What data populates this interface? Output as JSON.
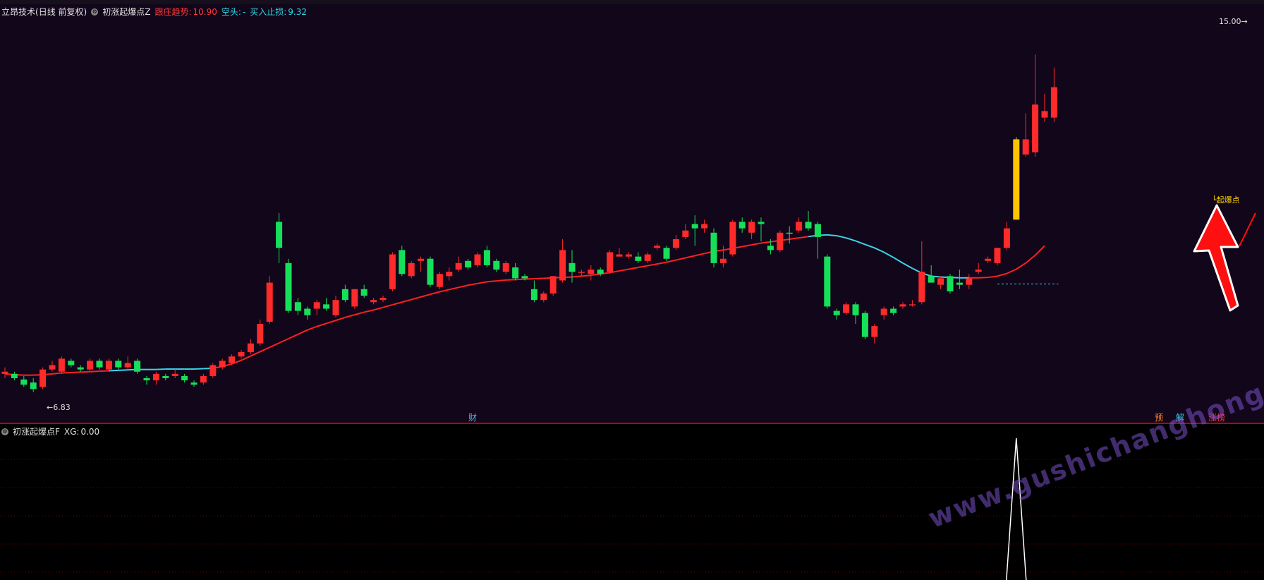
{
  "main_header": {
    "indicator_name": "立昂技术",
    "period": "(日线 前复权)",
    "formula_name": "初涨起爆点Z",
    "long_label": "跟庄趋势:",
    "long_value": "10.90",
    "short_label": "空头:",
    "short_value": "-",
    "stop_label": "买入止损:",
    "stop_value": "9.32"
  },
  "sub_header": {
    "formula_name": "初涨起爆点F",
    "xg_label": "XG:",
    "xg_value": "0.00"
  },
  "price_labels": {
    "high": "15.00",
    "low": "6.83",
    "signal": "起爆点"
  },
  "event_tags": [
    {
      "text": "财",
      "color": "#4fb6ff"
    },
    {
      "text": "预",
      "color": "#ff8a2a"
    },
    {
      "text": "解",
      "color": "#30d8e6"
    },
    {
      "text": "涨榜",
      "color": "#ff3b3b"
    }
  ],
  "watermark": "www.gushichanghong.com",
  "colors": {
    "up": "#ff2a2a",
    "down": "#16e05a",
    "signal_bar": "#ffc400",
    "trend_up": "#ff2020",
    "trend_down": "#38d6e8",
    "arrow": "#ff1010"
  },
  "chart_data": {
    "type": "candlestick",
    "ylim": [
      6.5,
      15.5
    ],
    "high_marker": 15.0,
    "low_marker": 6.83,
    "stop_line": 9.32,
    "candles": [
      [
        7.3,
        7.25,
        7.4,
        7.15,
        "u"
      ],
      [
        7.25,
        7.15,
        7.3,
        7.1,
        "d"
      ],
      [
        7.12,
        7.0,
        7.2,
        6.95,
        "d"
      ],
      [
        7.05,
        6.9,
        7.15,
        6.83,
        "d"
      ],
      [
        6.95,
        7.35,
        7.4,
        6.9,
        "u"
      ],
      [
        7.35,
        7.45,
        7.55,
        7.3,
        "u"
      ],
      [
        7.3,
        7.6,
        7.65,
        7.25,
        "u"
      ],
      [
        7.55,
        7.45,
        7.6,
        7.4,
        "d"
      ],
      [
        7.4,
        7.35,
        7.45,
        7.3,
        "d"
      ],
      [
        7.35,
        7.55,
        7.6,
        7.3,
        "u"
      ],
      [
        7.55,
        7.4,
        7.6,
        7.35,
        "d"
      ],
      [
        7.35,
        7.55,
        7.6,
        7.3,
        "u"
      ],
      [
        7.55,
        7.4,
        7.6,
        7.35,
        "d"
      ],
      [
        7.4,
        7.5,
        7.65,
        7.35,
        "u"
      ],
      [
        7.55,
        7.3,
        7.6,
        7.25,
        "d"
      ],
      [
        7.15,
        7.1,
        7.2,
        7.0,
        "d"
      ],
      [
        7.1,
        7.25,
        7.3,
        7.0,
        "u"
      ],
      [
        7.2,
        7.15,
        7.25,
        7.1,
        "d"
      ],
      [
        7.2,
        7.25,
        7.35,
        7.15,
        "u"
      ],
      [
        7.2,
        7.1,
        7.25,
        7.05,
        "d"
      ],
      [
        7.05,
        7.0,
        7.1,
        6.95,
        "d"
      ],
      [
        7.05,
        7.2,
        7.25,
        7.0,
        "u"
      ],
      [
        7.2,
        7.45,
        7.5,
        7.15,
        "u"
      ],
      [
        7.4,
        7.55,
        7.6,
        7.35,
        "u"
      ],
      [
        7.5,
        7.65,
        7.7,
        7.45,
        "u"
      ],
      [
        7.65,
        7.75,
        7.8,
        7.6,
        "u"
      ],
      [
        7.75,
        7.95,
        8.05,
        7.7,
        "u"
      ],
      [
        7.95,
        8.4,
        8.5,
        7.9,
        "u"
      ],
      [
        8.45,
        9.35,
        9.5,
        8.4,
        "u"
      ],
      [
        10.15,
        10.75,
        10.95,
        9.8,
        "d"
      ],
      [
        9.8,
        8.7,
        9.9,
        8.65,
        "d"
      ],
      [
        8.9,
        8.7,
        9.0,
        8.6,
        "d"
      ],
      [
        8.75,
        8.6,
        8.8,
        8.5,
        "d"
      ],
      [
        8.75,
        8.9,
        8.95,
        8.6,
        "u"
      ],
      [
        8.85,
        8.75,
        9.0,
        8.7,
        "d"
      ],
      [
        8.6,
        8.95,
        9.05,
        8.55,
        "u"
      ],
      [
        9.2,
        8.95,
        9.3,
        8.9,
        "d"
      ],
      [
        8.8,
        9.2,
        9.2,
        8.75,
        "u"
      ],
      [
        9.2,
        9.05,
        9.3,
        9.0,
        "d"
      ],
      [
        8.95,
        8.9,
        9.0,
        8.85,
        "u"
      ],
      [
        8.95,
        9.0,
        9.05,
        8.9,
        "u"
      ],
      [
        9.2,
        10.0,
        10.05,
        9.15,
        "u"
      ],
      [
        10.1,
        9.55,
        10.2,
        9.5,
        "d"
      ],
      [
        9.5,
        9.8,
        9.85,
        9.45,
        "u"
      ],
      [
        9.9,
        9.85,
        9.95,
        9.6,
        "u"
      ],
      [
        9.9,
        9.3,
        9.95,
        9.25,
        "d"
      ],
      [
        9.25,
        9.55,
        9.6,
        9.2,
        "u"
      ],
      [
        9.5,
        9.6,
        9.7,
        9.4,
        "u"
      ],
      [
        9.65,
        9.8,
        9.95,
        9.6,
        "u"
      ],
      [
        9.85,
        9.7,
        9.9,
        9.65,
        "d"
      ],
      [
        9.75,
        10.0,
        10.05,
        9.7,
        "u"
      ],
      [
        10.1,
        9.75,
        10.2,
        9.7,
        "d"
      ],
      [
        9.85,
        9.65,
        9.9,
        9.6,
        "d"
      ],
      [
        9.6,
        9.8,
        9.85,
        9.55,
        "u"
      ],
      [
        9.7,
        9.45,
        9.8,
        9.4,
        "d"
      ],
      [
        9.5,
        9.45,
        9.55,
        9.4,
        "d"
      ],
      [
        9.2,
        8.95,
        9.4,
        8.9,
        "d"
      ],
      [
        8.95,
        9.1,
        9.15,
        8.9,
        "u"
      ],
      [
        9.1,
        9.5,
        9.5,
        9.05,
        "u"
      ],
      [
        9.4,
        10.1,
        10.35,
        9.35,
        "u"
      ],
      [
        9.8,
        9.6,
        10.1,
        9.35,
        "d"
      ],
      [
        9.6,
        9.6,
        9.65,
        9.5,
        "u"
      ],
      [
        9.55,
        9.65,
        9.75,
        9.4,
        "u"
      ],
      [
        9.65,
        9.55,
        9.7,
        9.5,
        "d"
      ],
      [
        9.6,
        10.05,
        10.1,
        9.55,
        "u"
      ],
      [
        10.0,
        9.95,
        10.15,
        9.95,
        "u"
      ],
      [
        9.95,
        10.0,
        10.05,
        9.9,
        "u"
      ],
      [
        9.95,
        9.85,
        10.05,
        9.8,
        "d"
      ],
      [
        9.85,
        10.0,
        10.05,
        9.8,
        "u"
      ],
      [
        10.15,
        10.2,
        10.25,
        10.1,
        "u"
      ],
      [
        10.15,
        9.9,
        10.2,
        9.85,
        "d"
      ],
      [
        10.15,
        10.35,
        10.45,
        10.1,
        "u"
      ],
      [
        10.4,
        10.55,
        10.7,
        10.35,
        "u"
      ],
      [
        10.7,
        10.6,
        10.9,
        10.2,
        "d"
      ],
      [
        10.7,
        10.6,
        10.8,
        10.5,
        "u"
      ],
      [
        10.5,
        9.8,
        10.6,
        9.7,
        "d"
      ],
      [
        9.8,
        9.9,
        10.2,
        9.7,
        "u"
      ],
      [
        10.0,
        10.75,
        10.8,
        9.95,
        "u"
      ],
      [
        10.75,
        10.6,
        10.85,
        10.5,
        "d"
      ],
      [
        10.5,
        10.75,
        10.8,
        10.35,
        "u"
      ],
      [
        10.7,
        10.75,
        10.85,
        10.3,
        "d"
      ],
      [
        10.2,
        10.1,
        10.35,
        10.0,
        "d"
      ],
      [
        10.1,
        10.5,
        10.55,
        10.05,
        "u"
      ],
      [
        10.5,
        10.5,
        10.65,
        10.25,
        "d"
      ],
      [
        10.55,
        10.75,
        10.85,
        10.5,
        "u"
      ],
      [
        10.75,
        10.6,
        11.0,
        10.55,
        "d"
      ],
      [
        10.7,
        10.4,
        10.75,
        9.9,
        "d"
      ],
      [
        9.95,
        8.8,
        10.0,
        8.75,
        "d"
      ],
      [
        8.7,
        8.6,
        8.75,
        8.5,
        "d"
      ],
      [
        8.65,
        8.85,
        8.9,
        8.6,
        "u"
      ],
      [
        8.85,
        8.6,
        8.9,
        8.4,
        "d"
      ],
      [
        8.65,
        8.1,
        8.7,
        8.05,
        "d"
      ],
      [
        8.1,
        8.35,
        8.4,
        7.95,
        "u"
      ],
      [
        8.6,
        8.75,
        8.8,
        8.5,
        "u"
      ],
      [
        8.75,
        8.65,
        8.8,
        8.6,
        "d"
      ],
      [
        8.8,
        8.85,
        8.9,
        8.75,
        "u"
      ],
      [
        8.85,
        8.85,
        8.95,
        8.8,
        "u"
      ],
      [
        8.9,
        9.6,
        10.3,
        8.85,
        "u"
      ],
      [
        9.5,
        9.35,
        9.75,
        9.35,
        "d"
      ],
      [
        9.45,
        9.3,
        9.5,
        9.2,
        "u"
      ],
      [
        9.5,
        9.15,
        9.55,
        9.1,
        "d"
      ],
      [
        9.3,
        9.35,
        9.65,
        9.2,
        "d"
      ],
      [
        9.3,
        9.45,
        9.55,
        9.2,
        "u"
      ],
      [
        9.6,
        9.65,
        9.8,
        9.55,
        "u"
      ],
      [
        9.85,
        9.9,
        9.95,
        9.8,
        "u"
      ],
      [
        9.8,
        10.15,
        10.15,
        9.75,
        "u"
      ],
      [
        10.15,
        10.6,
        10.75,
        10.1,
        "u"
      ],
      [
        10.8,
        12.65,
        12.7,
        10.8,
        "s"
      ],
      [
        12.3,
        12.65,
        13.25,
        12.25,
        "u"
      ],
      [
        12.35,
        13.45,
        14.6,
        12.25,
        "u"
      ],
      [
        13.3,
        13.15,
        13.7,
        13.05,
        "u"
      ],
      [
        13.15,
        13.85,
        14.3,
        13.05,
        "u"
      ]
    ],
    "trend": [
      7.25,
      7.23,
      7.22,
      7.22,
      7.23,
      7.25,
      7.27,
      7.28,
      7.29,
      7.3,
      7.31,
      7.32,
      7.33,
      7.34,
      7.35,
      7.35,
      7.35,
      7.36,
      7.36,
      7.36,
      7.36,
      7.37,
      7.38,
      7.42,
      7.48,
      7.56,
      7.66,
      7.76,
      7.86,
      7.96,
      8.06,
      8.16,
      8.26,
      8.34,
      8.41,
      8.48,
      8.55,
      8.61,
      8.67,
      8.72,
      8.78,
      8.84,
      8.9,
      8.96,
      9.02,
      9.08,
      9.14,
      9.19,
      9.24,
      9.29,
      9.33,
      9.37,
      9.39,
      9.41,
      9.42,
      9.43,
      9.44,
      9.45,
      9.46,
      9.47,
      9.48,
      9.5,
      9.52,
      9.55,
      9.58,
      9.62,
      9.66,
      9.7,
      9.74,
      9.78,
      9.82,
      9.87,
      9.92,
      9.97,
      10.02,
      10.07,
      10.1,
      10.14,
      10.18,
      10.22,
      10.26,
      10.29,
      10.32,
      10.35,
      10.38,
      10.41,
      10.44,
      10.45,
      10.43,
      10.38,
      10.31,
      10.23,
      10.15,
      10.05,
      9.93,
      9.8,
      9.68,
      9.57,
      9.5,
      9.48,
      9.47,
      9.46,
      9.46,
      9.46,
      9.47,
      9.5,
      9.56,
      9.66,
      9.8,
      9.98,
      10.2
    ],
    "trend_down_ranges": [
      [
        11,
        22
      ],
      [
        85,
        102
      ]
    ]
  }
}
